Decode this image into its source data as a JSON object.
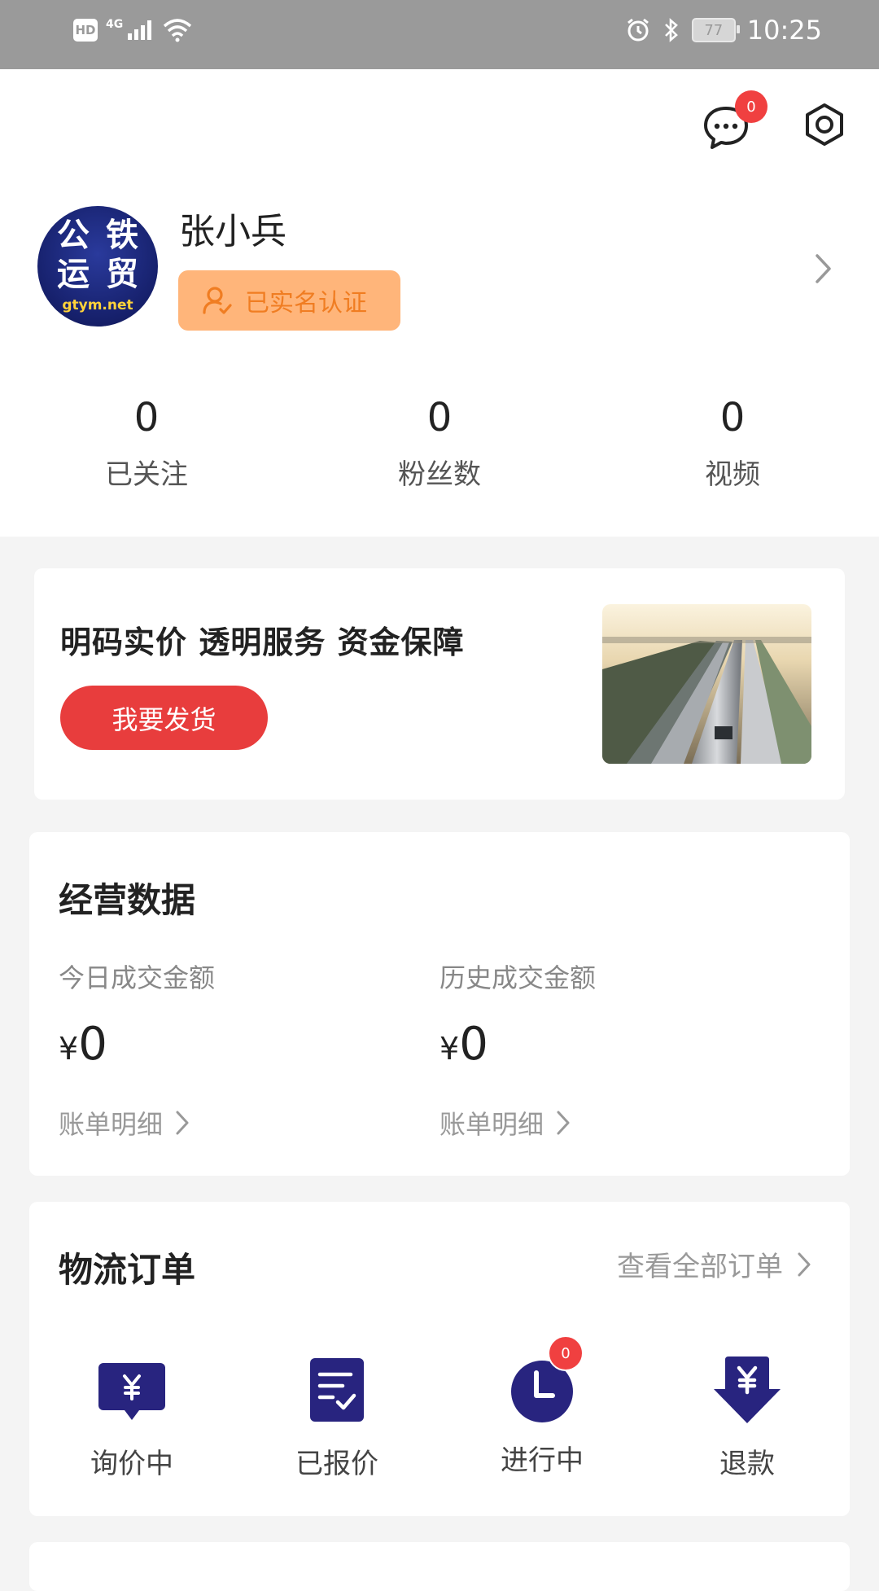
{
  "status_bar": {
    "hd": "HD",
    "network": "4G",
    "battery": "77",
    "time": "10:25"
  },
  "header": {
    "message_badge": "0"
  },
  "profile": {
    "avatar_chars": [
      "公",
      "铁",
      "运",
      "贸"
    ],
    "avatar_url": "gtym.net",
    "name": "张小兵",
    "verify_label": "已实名认证"
  },
  "stats": [
    {
      "value": "0",
      "label": "已关注"
    },
    {
      "value": "0",
      "label": "粉丝数"
    },
    {
      "value": "0",
      "label": "视频"
    }
  ],
  "banner": {
    "title": "明码实价 透明服务 资金保障",
    "button": "我要发货"
  },
  "business": {
    "title": "经营数据",
    "today_label": "今日成交金额",
    "today_currency": "¥",
    "today_amount": "0",
    "history_label": "历史成交金额",
    "history_currency": "¥",
    "history_amount": "0",
    "detail_link": "账单明细"
  },
  "orders": {
    "title": "物流订单",
    "view_all": "查看全部订单",
    "items": [
      {
        "label": "询价中",
        "icon": "inquiry-icon"
      },
      {
        "label": "已报价",
        "icon": "quoted-icon"
      },
      {
        "label": "进行中",
        "icon": "clock-icon",
        "badge": "0"
      },
      {
        "label": "退款",
        "icon": "refund-icon"
      }
    ]
  },
  "colors": {
    "accent_red": "#e83d3d",
    "badge_red": "#f04040",
    "verify_bg": "#ffb57a",
    "verify_text": "#f07d22",
    "icon_navy": "#28247f"
  }
}
